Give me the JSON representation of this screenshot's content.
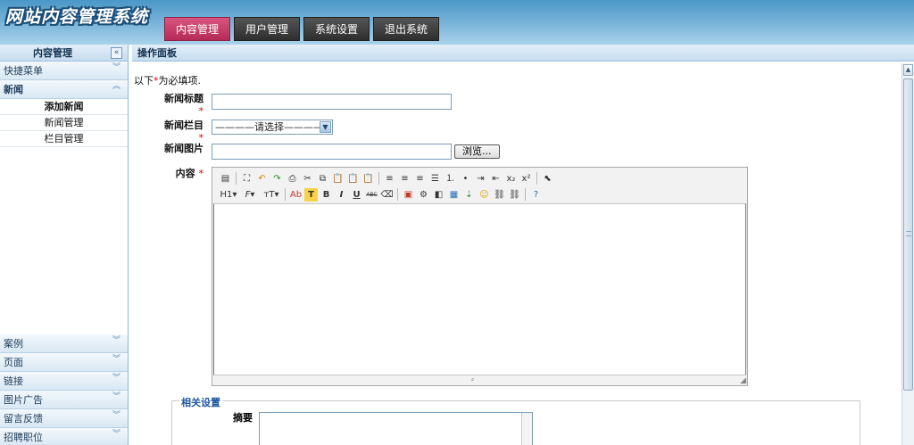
{
  "header": {
    "logo_text": "网站内容管理系统",
    "nav": [
      {
        "label": "内容管理",
        "active": true
      },
      {
        "label": "用户管理",
        "active": false
      },
      {
        "label": "系统设置",
        "active": false
      },
      {
        "label": "退出系统",
        "active": false
      }
    ]
  },
  "sidebar": {
    "title": "内容管理",
    "collapse_icon": "double-chevron-left-icon",
    "menus": [
      {
        "label": "快捷菜单",
        "expanded": false
      },
      {
        "label": "新闻",
        "expanded": true
      }
    ],
    "submenu": [
      {
        "label": "添加新闻",
        "selected": true
      },
      {
        "label": "新闻管理",
        "selected": false
      },
      {
        "label": "栏目管理",
        "selected": false
      }
    ],
    "bottom_menus": [
      {
        "label": "案例"
      },
      {
        "label": "页面"
      },
      {
        "label": "链接"
      },
      {
        "label": "图片广告"
      },
      {
        "label": "留言反馈"
      },
      {
        "label": "招聘职位"
      }
    ]
  },
  "panel": {
    "title": "操作面板",
    "note_prefix": "以下",
    "note_mark": "*",
    "note_suffix": "为必填项."
  },
  "form": {
    "title_label": "新闻标题",
    "title_value": "",
    "category_label": "新闻栏目",
    "category_selected": "————请选择————",
    "image_label": "新闻图片",
    "image_value": "",
    "browse_label": "浏览...",
    "content_label": "内容",
    "required_mark": "*"
  },
  "editor": {
    "toolbar_row1": [
      "source-icon",
      "preview-icon",
      "undo-icon",
      "redo-icon",
      "print-icon",
      "cut-icon",
      "copy-icon",
      "paste-icon",
      "paste-text-icon",
      "paste-word-icon",
      "align-left-icon",
      "align-center-icon",
      "align-right-icon",
      "justify-icon",
      "ordered-list-icon",
      "unordered-list-icon",
      "indent-icon",
      "outdent-icon",
      "subscript-icon",
      "superscript-icon",
      "select-all-icon"
    ],
    "toolbar_row2": {
      "heading": "H1",
      "font": "F",
      "size": "тT",
      "forecolor": "Ab",
      "hilite": "T",
      "bold": "B",
      "italic": "I",
      "underline": "U",
      "strike": "ABC"
    }
  },
  "related": {
    "legend": "相关设置",
    "summary_label": "摘要",
    "summary_value": ""
  },
  "colors": {
    "accent_tab": "#b52a58",
    "header_blue": "#4a97c6",
    "required": "#dd0000",
    "legend_blue": "#1f58a0"
  }
}
